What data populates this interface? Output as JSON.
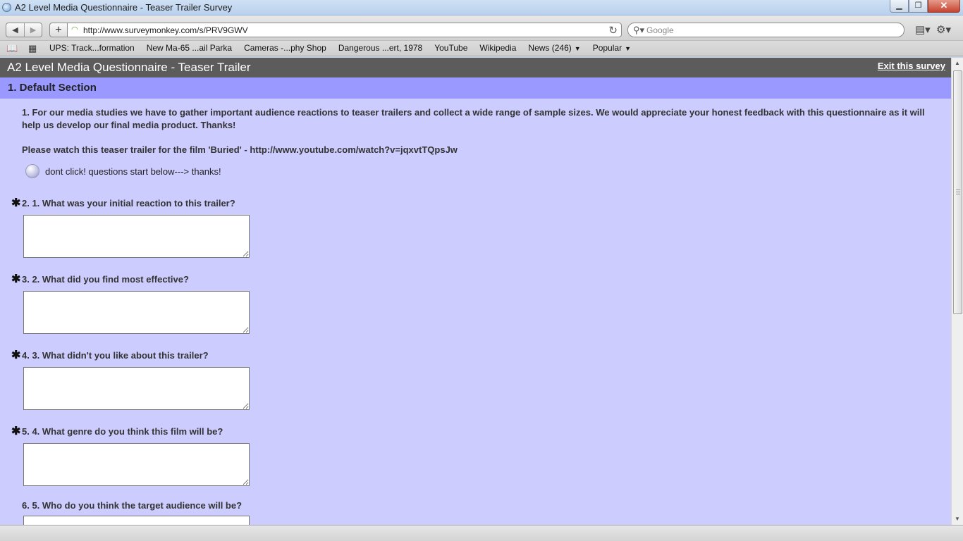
{
  "window": {
    "title": "A2 Level Media Questionnaire - Teaser Trailer Survey",
    "minimize": "▁",
    "maximize": "❐",
    "close": "✕"
  },
  "toolbar": {
    "back": "◀",
    "forward": "▶",
    "add": "+",
    "url": "http://www.surveymonkey.com/s/PRV9GWV",
    "reload": "↻",
    "search_placeholder": "Google",
    "page_menu": "▤▾",
    "settings_menu": "⚙▾"
  },
  "bookmarks": {
    "items": [
      {
        "label": "UPS: Track...formation"
      },
      {
        "label": "New Ma-65 ...ail Parka"
      },
      {
        "label": "Cameras -...phy Shop"
      },
      {
        "label": "Dangerous ...ert, 1978"
      },
      {
        "label": "YouTube"
      },
      {
        "label": "Wikipedia"
      },
      {
        "label": "News (246)",
        "arrow": "▼"
      },
      {
        "label": "Popular",
        "arrow": "▼"
      }
    ]
  },
  "survey": {
    "title": "A2 Level Media Questionnaire - Teaser Trailer",
    "exit_label": "Exit this survey",
    "section_title": "1. Default Section",
    "intro": "1. For our media studies we have to gather important audience reactions to teaser trailers and collect a wide range of sample sizes. We would appreciate your honest feedback with this questionnaire as it will help us develop our final media product. Thanks!",
    "watch_text": "Please watch this teaser trailer for the film 'Buried' - http://www.youtube.com/watch?v=jqxvtTQpsJw",
    "radio_label": "dont click! questions start below---> thanks!",
    "required_marker": "✱",
    "questions": [
      {
        "label": "2. 1. What was your initial reaction to this trailer?",
        "required": true,
        "value": ""
      },
      {
        "label": "3. 2. What did you find most effective?",
        "required": true,
        "value": ""
      },
      {
        "label": "4. 3. What didn't you like about this trailer?",
        "required": true,
        "value": ""
      },
      {
        "label": "5. 4. What genre do you think this film will be?",
        "required": true,
        "value": ""
      },
      {
        "label": "6. 5. Who do you think the target audience will be?",
        "required": false,
        "value": ""
      }
    ]
  },
  "scrollbar": {
    "up": "▲",
    "down": "▼"
  }
}
